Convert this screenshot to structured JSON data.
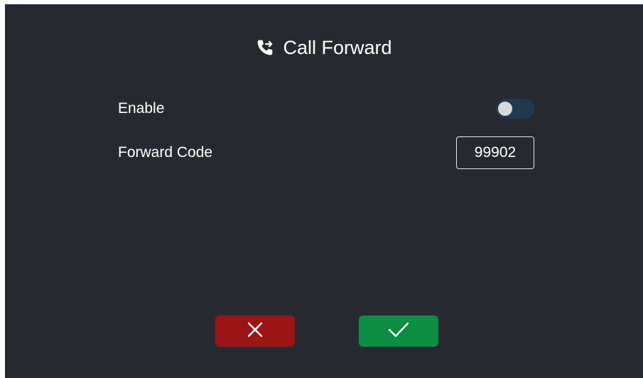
{
  "header": {
    "title": "Call Forward",
    "icon": "phone-forward-icon"
  },
  "settings": {
    "enable": {
      "label": "Enable",
      "enabled": false
    },
    "forward_code": {
      "label": "Forward Code",
      "value": "99902"
    }
  },
  "actions": {
    "cancel_icon": "close-icon",
    "confirm_icon": "check-icon"
  },
  "colors": {
    "background": "#262a30",
    "cancel": "#9b1516",
    "confirm": "#0d8c43",
    "toggle_off": "#1f3a4f"
  }
}
